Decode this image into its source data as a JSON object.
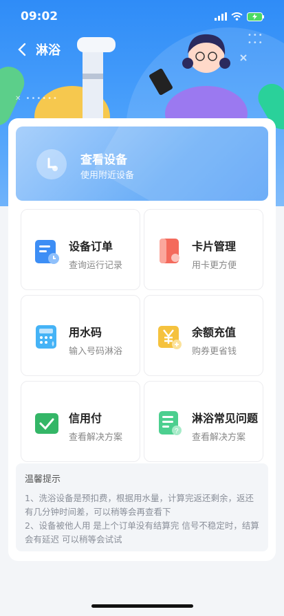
{
  "status_bar": {
    "time": "09:02"
  },
  "nav": {
    "title": "淋浴"
  },
  "device_card": {
    "title": "查看设备",
    "subtitle": "使用附近设备"
  },
  "tiles": [
    {
      "title": "设备订单",
      "subtitle": "查询运行记录",
      "icon": "order-icon",
      "color": "#3d8ef5"
    },
    {
      "title": "卡片管理",
      "subtitle": "用卡更方便",
      "icon": "card-icon",
      "color": "#f46a5c"
    },
    {
      "title": "用水码",
      "subtitle": "输入号码淋浴",
      "icon": "calculator-icon",
      "color": "#45b3f6"
    },
    {
      "title": "余额充值",
      "subtitle": "购券更省钱",
      "icon": "yen-icon",
      "color": "#f5c23e"
    },
    {
      "title": "信用付",
      "subtitle": "查看解决方案",
      "icon": "check-icon",
      "color": "#34b667"
    },
    {
      "title": "淋浴常见问题",
      "subtitle": "查看解决方案",
      "icon": "faq-icon",
      "color": "#4ccf8f"
    }
  ],
  "tips": {
    "title": "温馨提示",
    "line1": "1、洗浴设备是预扣费，根据用水量，计算完返还剩余，返还有几分钟时间差，可以稍等会再查看下",
    "line2": "2、设备被他人用 是上个订单没有结算完 信号不稳定时，结算会有延迟 可以稍等会试试"
  },
  "colors": {
    "primary": "#3d8ef5",
    "background": "#f3f5f8"
  }
}
